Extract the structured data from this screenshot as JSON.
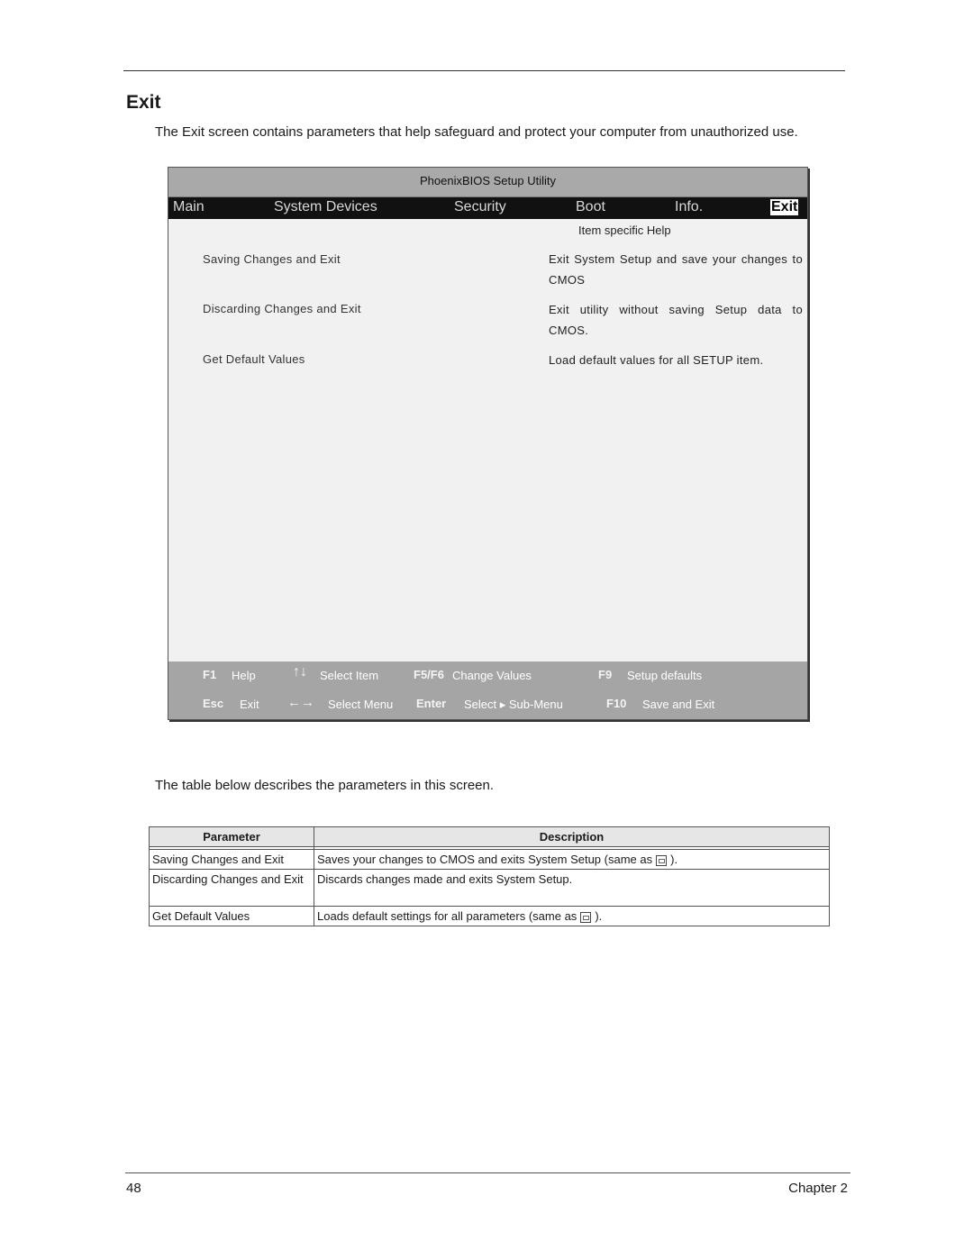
{
  "page": {
    "heading": "Exit",
    "intro": "The Exit screen contains parameters that help safeguard and protect your computer from unauthorized use.",
    "table_intro": "The table below describes the parameters in this screen.",
    "page_number": "48",
    "chapter": "Chapter 2"
  },
  "bios": {
    "title": "PhoenixBIOS Setup Utility",
    "tabs": [
      {
        "label": "Main",
        "active": false
      },
      {
        "label": "System Devices",
        "active": false
      },
      {
        "label": "Security",
        "active": false
      },
      {
        "label": "Boot",
        "active": false
      },
      {
        "label": "Info.",
        "active": false
      },
      {
        "label": "Exit",
        "active": true
      }
    ],
    "help_header": "Item specific Help",
    "options": [
      {
        "label": "Saving Changes and Exit",
        "help": "Exit System Setup and save your changes to CMOS"
      },
      {
        "label": "Discarding Changes and Exit",
        "help": "Exit utility without saving Setup data to CMOS."
      },
      {
        "label": "Get Default Values",
        "help": "Load default values for all SETUP item."
      }
    ],
    "footer": {
      "row1": [
        {
          "key": "F1",
          "action": "Help"
        },
        {
          "key": "↑↓",
          "action": "Select Item"
        },
        {
          "key": "F5/F6",
          "action": "Change Values"
        },
        {
          "key": "F9",
          "action": "Setup defaults"
        }
      ],
      "row2": [
        {
          "key": "Esc",
          "action": "Exit"
        },
        {
          "key": "←→",
          "action": "Select Menu"
        },
        {
          "key": "Enter",
          "action": "Select ▸ Sub-Menu"
        },
        {
          "key": "F10",
          "action": "Save and Exit"
        }
      ]
    }
  },
  "table": {
    "headers": [
      "Parameter",
      "Description"
    ],
    "rows": [
      {
        "parameter": "Saving Changes and Exit",
        "description": "Saves your changes to CMOS and exits System Setup (same as",
        "suffix": ").",
        "icon": "f10-key-icon"
      },
      {
        "parameter": "Discarding Changes and Exit",
        "description": "Discards changes made and exits System Setup."
      },
      {
        "parameter": "Get Default Values",
        "description": "Loads default settings for all parameters (same as",
        "suffix": ").",
        "icon": "f9-key-icon"
      }
    ]
  }
}
